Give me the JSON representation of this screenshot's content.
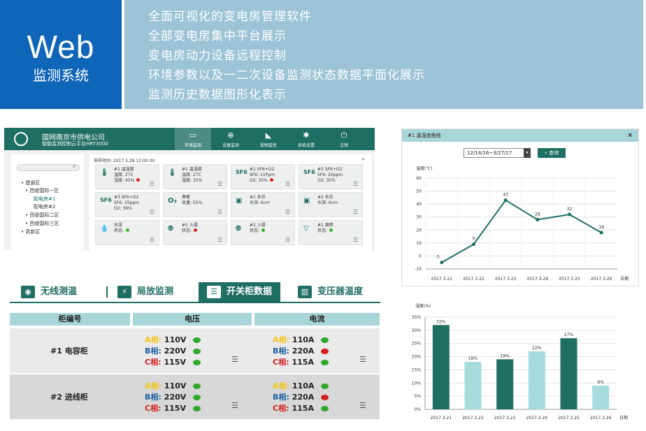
{
  "banner": {
    "web": "Web",
    "sub": "监测系统",
    "lines": [
      "全面可视化的变电房管理软件",
      "全部变电房集中平台展示",
      "变电房动力设备远程控制",
      "环境参数以及一二次设备监测状态数据平面化展示",
      "监测历史数据图形化表示"
    ]
  },
  "dashboard": {
    "company": "国网南京市供电公司",
    "system": "智能监测控制云平台HRT3000",
    "nav": [
      {
        "icon": "monitor-icon",
        "glyph": "▭",
        "label": "环境监测"
      },
      {
        "icon": "target-icon",
        "glyph": "⊕",
        "label": "设备监测"
      },
      {
        "icon": "camera-icon",
        "glyph": "◣",
        "label": "视频监控"
      },
      {
        "icon": "gear-icon",
        "glyph": "✱",
        "label": "系统设置"
      },
      {
        "icon": "power-icon",
        "glyph": "⏻",
        "label": "注销"
      }
    ],
    "tree": [
      "建邺区",
      "西堤国际一区",
      "配电房#1",
      "配电房#2",
      "西堤国际二区",
      "西堤国际三区",
      "高新区"
    ],
    "refresh_time": "采样时间: 2017.3.28  12:00:30",
    "chevron": "»",
    "cards": [
      {
        "icon": "thermometer-icon",
        "glyph": "🌡",
        "lines": [
          "#1 温湿度",
          "温度: 27C",
          "湿度: 45%"
        ],
        "status": "red"
      },
      {
        "icon": "thermometer-icon",
        "glyph": "🌡",
        "lines": [
          "#1 温湿度",
          "温度: 27C",
          "湿度: 35%"
        ],
        "status": ""
      },
      {
        "icon": "sf6-icon",
        "glyph": "SF6",
        "lines": [
          "#1 SF6+O2",
          "SF6: 11Ppm",
          "O2: 35%"
        ],
        "status": "red"
      },
      {
        "icon": "sf6-icon",
        "glyph": "SF6",
        "lines": [
          "#2 SF6+O2",
          "SF6: 20ppm",
          "O2: 35%"
        ],
        "status": ""
      },
      {
        "icon": "sf6-icon",
        "glyph": "SF6",
        "lines": [
          "#3 SF6+O2",
          "SF6: 25ppm",
          "O2: 36%"
        ],
        "status": ""
      },
      {
        "icon": "ozone-icon",
        "glyph": "O₃",
        "lines": [
          "臭氧",
          "含量: 55%"
        ],
        "status": ""
      },
      {
        "icon": "water-level-icon",
        "glyph": "▣",
        "lines": [
          "#1 水位",
          "水深: 6cm"
        ],
        "status": ""
      },
      {
        "icon": "water-level-icon",
        "glyph": "▣",
        "lines": [
          "#2 水位",
          "水深: 6cm"
        ],
        "status": ""
      },
      {
        "icon": "water-drop-icon",
        "glyph": "💧",
        "lines": [
          "水浸",
          "状态:"
        ],
        "status": "green"
      },
      {
        "icon": "sensor-icon",
        "glyph": "⦾",
        "lines": [
          "#1 入侵",
          "状态:"
        ],
        "status": "red"
      },
      {
        "icon": "sensor-icon",
        "glyph": "⦾",
        "lines": [
          "#2 入侵",
          "状态:"
        ],
        "status": "green"
      },
      {
        "icon": "smoke-icon",
        "glyph": "▽",
        "lines": [
          "#1 烟感",
          "状态:"
        ],
        "status": "green"
      }
    ]
  },
  "switchgear": {
    "tabs": [
      {
        "icon": "wireless-icon",
        "glyph": "◉",
        "label": "无线测温"
      },
      {
        "icon": "discharge-icon",
        "glyph": "⚡",
        "label": "局放监测"
      },
      {
        "icon": "cabinet-icon",
        "glyph": "☰",
        "label": "开关柜数据",
        "active": true
      },
      {
        "icon": "transformer-icon",
        "glyph": "▥",
        "label": "变压器温度"
      }
    ],
    "headers": [
      "柜编号",
      "电压",
      "电流"
    ],
    "rows": [
      {
        "id": "#1 电容柜",
        "voltage": [
          {
            "phase": "A相:",
            "value": "110V",
            "led": "g"
          },
          {
            "phase": "B相:",
            "value": "220V",
            "led": "g"
          },
          {
            "phase": "C相:",
            "value": "115V",
            "led": "g"
          }
        ],
        "current": [
          {
            "phase": "A相:",
            "value": "110A",
            "led": "g"
          },
          {
            "phase": "B相:",
            "value": "220A",
            "led": "r"
          },
          {
            "phase": "C相:",
            "value": "115A",
            "led": "g"
          }
        ]
      },
      {
        "id": "#2 进线柜",
        "voltage": [
          {
            "phase": "A相:",
            "value": "110V",
            "led": "g"
          },
          {
            "phase": "B相:",
            "value": "220V",
            "led": "g"
          },
          {
            "phase": "C相:",
            "value": "115V",
            "led": "g"
          }
        ],
        "current": [
          {
            "phase": "A相:",
            "value": "110A",
            "led": "g"
          },
          {
            "phase": "B相:",
            "value": "220A",
            "led": "r"
          },
          {
            "phase": "C相:",
            "value": "115A",
            "led": "g"
          }
        ]
      }
    ]
  },
  "history": {
    "title": "#1 温湿度曲线",
    "close": "×",
    "date_range": "12/14/16~3/27/17",
    "query": "查询",
    "dropdown_glyph": "▾"
  },
  "chart_data": [
    {
      "type": "line",
      "title": "",
      "ylabel": "温度(℃)",
      "xlabel": "日期",
      "categories": [
        "2017.3.21",
        "2017.3.22",
        "2017.3.23",
        "2017.3.24",
        "2017.3.25",
        "2017.3.26"
      ],
      "values": [
        -5,
        9,
        43,
        28,
        32,
        18
      ],
      "data_labels": [
        "-5",
        "9",
        "43",
        "28",
        "32",
        "18"
      ],
      "ylim": [
        -10,
        60
      ],
      "yticks": [
        "60",
        "50",
        "40",
        "30",
        "20",
        "10",
        "0",
        "-10"
      ],
      "color": "#1f6e63",
      "grid": true
    },
    {
      "type": "bar",
      "title": "",
      "ylabel": "湿度(%)",
      "xlabel": "日期",
      "categories": [
        "2017.3.21",
        "2017.3.22",
        "2017.3.23",
        "2017.3.24",
        "2017.3.25",
        "2017.3.26"
      ],
      "values": [
        32,
        18,
        19,
        22,
        27,
        9
      ],
      "data_labels": [
        "32%",
        "18%",
        "19%",
        "22%",
        "27%",
        "9%"
      ],
      "colors": [
        "#1f6e63",
        "#a8dcdc",
        "#1f6e63",
        "#a8dcdc",
        "#1f6e63",
        "#a8dcdc"
      ],
      "ylim": [
        0,
        35
      ],
      "yticks": [
        "35%",
        "30%",
        "25%",
        "20%",
        "15%",
        "10%",
        "5%",
        "0%"
      ],
      "grid": true
    }
  ]
}
